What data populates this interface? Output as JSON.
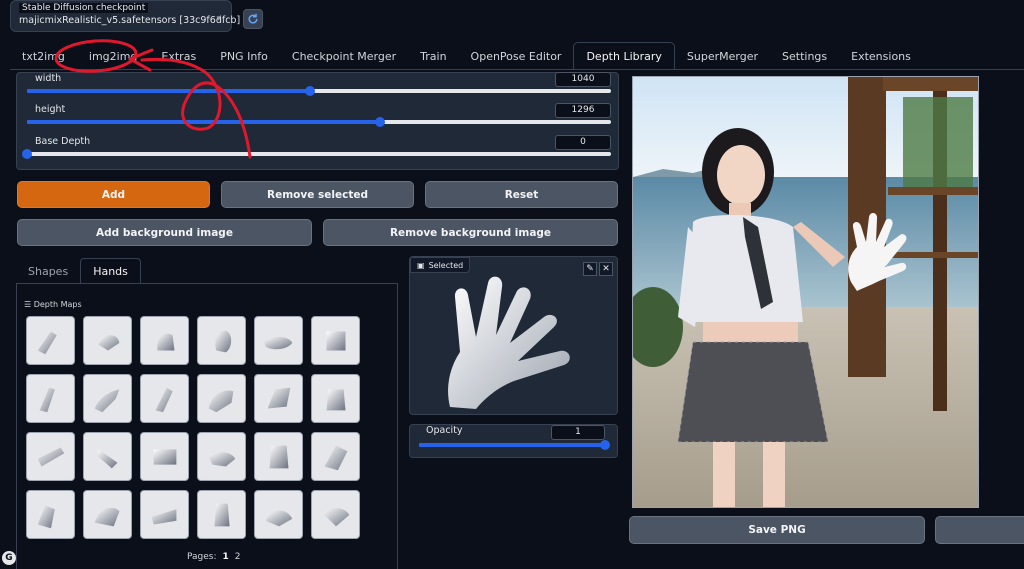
{
  "checkpoint": {
    "label": "Stable Diffusion checkpoint",
    "value": "majicmixRealistic_v5.safetensors [33c9f6dfcb]"
  },
  "tabs": [
    {
      "label": "txt2img"
    },
    {
      "label": "img2img"
    },
    {
      "label": "Extras"
    },
    {
      "label": "PNG Info"
    },
    {
      "label": "Checkpoint Merger"
    },
    {
      "label": "Train"
    },
    {
      "label": "OpenPose Editor"
    },
    {
      "label": "Depth Library",
      "active": true
    },
    {
      "label": "SuperMerger"
    },
    {
      "label": "Settings"
    },
    {
      "label": "Extensions"
    }
  ],
  "sliders": {
    "width": {
      "label": "width",
      "value": "1040",
      "fraction": 0.485
    },
    "height": {
      "label": "height",
      "value": "1296",
      "fraction": 0.605
    },
    "base_depth": {
      "label": "Base Depth",
      "value": "0",
      "fraction": 0.0
    }
  },
  "buttons": {
    "add": "Add",
    "remove_selected": "Remove selected",
    "reset": "Reset",
    "add_bg": "Add background image",
    "remove_bg": "Remove background image",
    "save_png": "Save PNG"
  },
  "library": {
    "tabs": [
      {
        "label": "Shapes"
      },
      {
        "label": "Hands",
        "active": true
      }
    ],
    "header": "Depth Maps",
    "pages_label": "Pages:",
    "pages": [
      "1",
      "2"
    ]
  },
  "selected": {
    "label": "Selected"
  },
  "opacity": {
    "label": "Opacity",
    "value": "1",
    "fraction": 1.0
  },
  "colors": {
    "accent": "#2563eb",
    "primary_button": "#d4670f",
    "background": "#0b0f19",
    "annotation": "#e0182d"
  }
}
